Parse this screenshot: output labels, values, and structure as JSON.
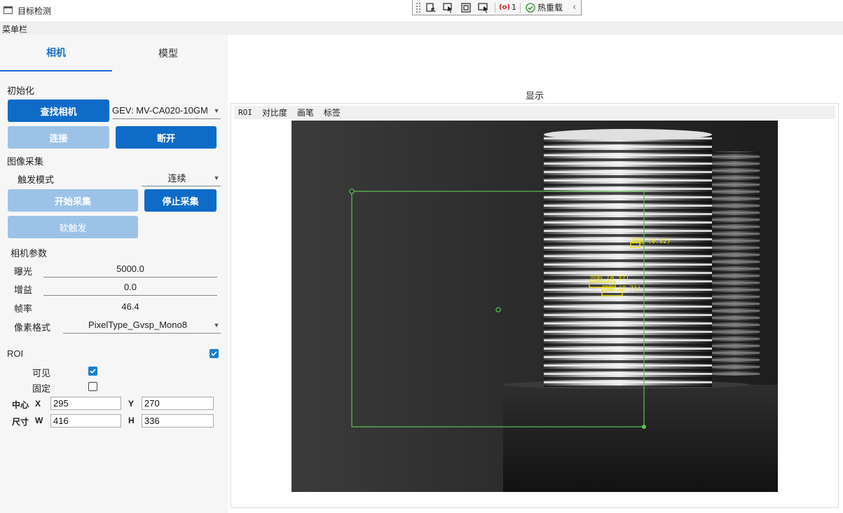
{
  "window": {
    "title": "目标检测"
  },
  "debug_toolbar": {
    "binding_errors": "1",
    "hot_reload_label": "热重载"
  },
  "menubar": {
    "label": "菜单栏"
  },
  "tabs": [
    {
      "label": "相机"
    },
    {
      "label": "模型"
    }
  ],
  "init": {
    "section_title": "初始化",
    "find_camera_label": "查找相机",
    "camera_device_value": "GEV: MV-CA020-10GM",
    "connect_label": "连接",
    "disconnect_label": "断开"
  },
  "acquisition": {
    "section_title": "图像采集",
    "trigger_mode_label": "触发模式",
    "trigger_mode_value": "连续",
    "start_label": "开始采集",
    "stop_label": "停止采集",
    "soft_trigger_label": "软触发"
  },
  "camera_params": {
    "section_title": "相机参数",
    "exposure_label": "曝光",
    "exposure_value": "5000.0",
    "gain_label": "增益",
    "gain_value": "0.0",
    "framerate_label": "帧率",
    "framerate_value": "46.4",
    "pixel_format_label": "像素格式",
    "pixel_format_value": "PixelType_Gvsp_Mono8"
  },
  "roi": {
    "section_title": "ROI",
    "enabled": true,
    "visible_label": "可见",
    "visible": true,
    "fixed_label": "固定",
    "fixed": false,
    "center_label": "中心",
    "x_label": "X",
    "x_value": "295",
    "y_label": "Y",
    "y_value": "270",
    "size_label": "尺寸",
    "w_label": "W",
    "w_value": "416",
    "h_label": "H",
    "h_value": "336"
  },
  "display": {
    "title": "显示",
    "toolbar": [
      "ROI",
      "对比度",
      "画笔",
      "标签"
    ],
    "detections": [
      {
        "label": "凹陷 (0.82)"
      },
      {
        "label": "凹陷 (0.37)"
      },
      {
        "label": "凹陷 (0.71)"
      }
    ]
  },
  "colors": {
    "accent": "#0e6bc8",
    "accent_disabled": "#9cc3e7",
    "roi_outline": "#58c451",
    "detection_box": "#f2e400"
  }
}
